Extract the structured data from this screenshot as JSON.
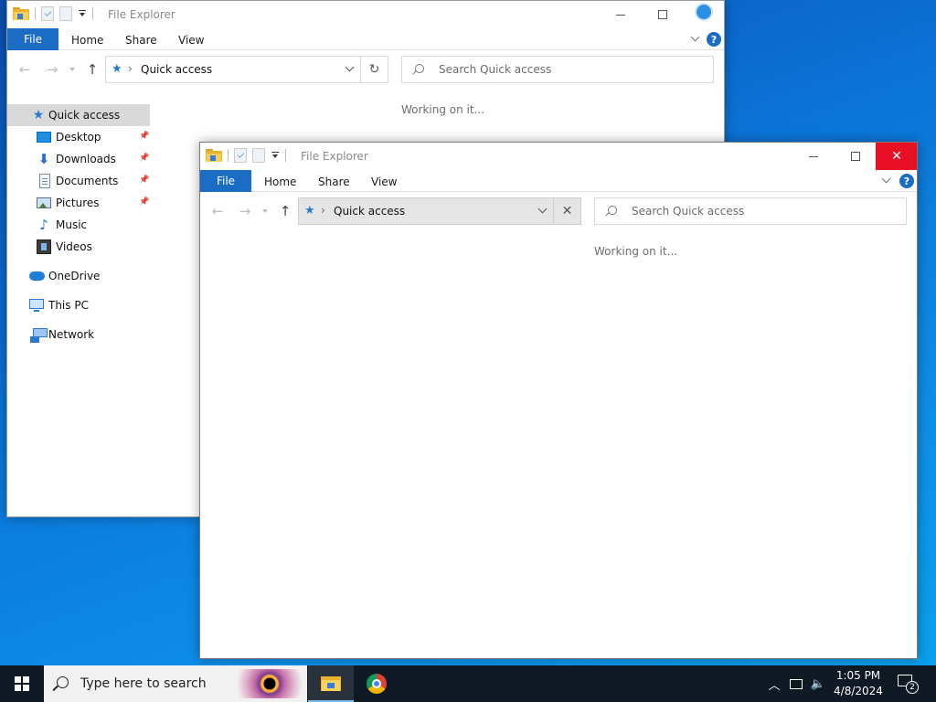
{
  "desktop": {
    "background_color": "#0b78d8"
  },
  "back_window": {
    "title": "File Explorer",
    "ribbon_tabs": {
      "file": "File",
      "home": "Home",
      "share": "Share",
      "view": "View"
    },
    "address": "Quick access",
    "search_placeholder": "Search Quick access",
    "status": "Working on it...",
    "nav_items": [
      {
        "label": "Quick access",
        "icon": "quick-access-star-icon",
        "selected": true
      },
      {
        "label": "Desktop",
        "icon": "desktop-icon",
        "pinned": true
      },
      {
        "label": "Downloads",
        "icon": "downloads-icon",
        "pinned": true
      },
      {
        "label": "Documents",
        "icon": "documents-icon",
        "pinned": true
      },
      {
        "label": "Pictures",
        "icon": "pictures-icon",
        "pinned": true
      },
      {
        "label": "Music",
        "icon": "music-icon"
      },
      {
        "label": "Videos",
        "icon": "videos-icon"
      },
      {
        "label": "OneDrive",
        "icon": "onedrive-icon"
      },
      {
        "label": "This PC",
        "icon": "this-pc-icon"
      },
      {
        "label": "Network",
        "icon": "network-icon"
      }
    ]
  },
  "front_window": {
    "title": "File Explorer",
    "ribbon_tabs": {
      "file": "File",
      "home": "Home",
      "share": "Share",
      "view": "View"
    },
    "address": "Quick access",
    "search_placeholder": "Search Quick access",
    "status": "Working on it..."
  },
  "taskbar": {
    "search_placeholder": "Type here to search",
    "time": "1:05 PM",
    "date": "4/8/2024",
    "notification_count": "2",
    "accent_color": "#76b9ed"
  },
  "icons": {
    "close": "close-icon",
    "refresh": "refresh-icon",
    "help": "help-icon",
    "pin": "pin-icon"
  }
}
